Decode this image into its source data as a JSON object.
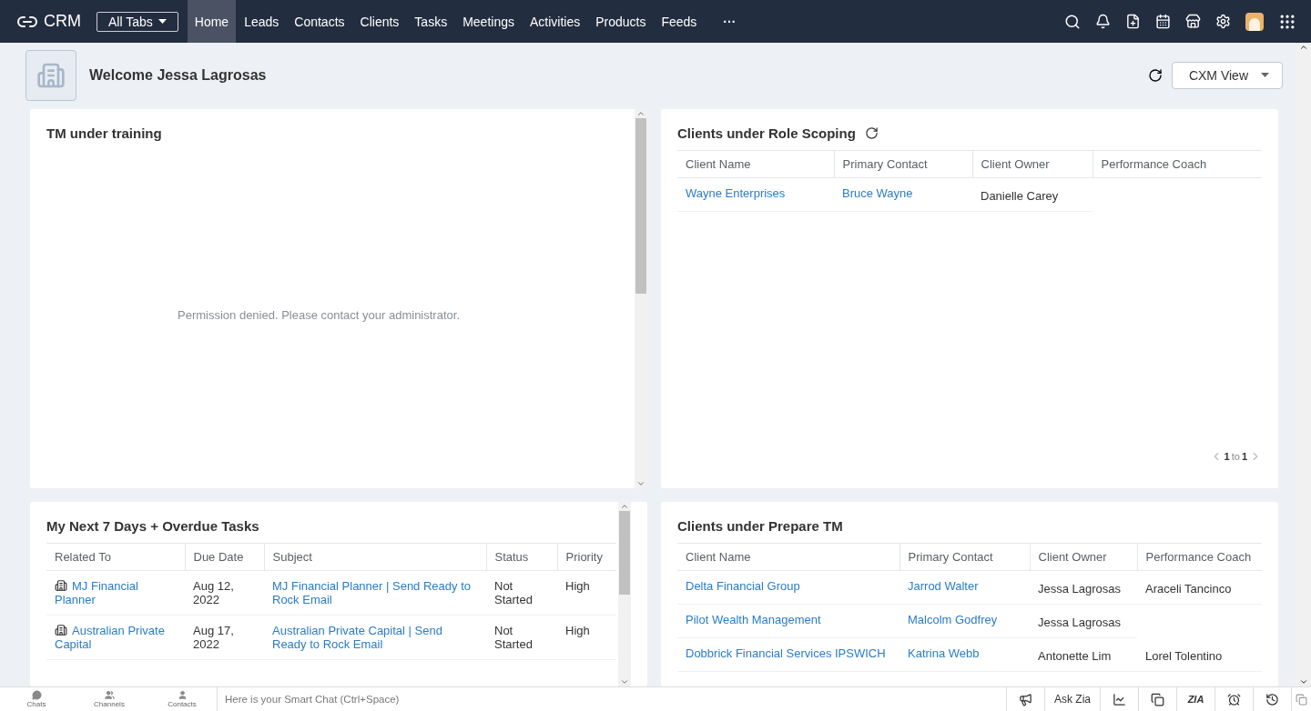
{
  "topbar": {
    "logo": "CRM",
    "all_tabs": "All Tabs",
    "more": "···",
    "tabs": [
      {
        "label": "Home",
        "selected": true
      },
      {
        "label": "Leads",
        "selected": false
      },
      {
        "label": "Contacts",
        "selected": false
      },
      {
        "label": "Clients",
        "selected": false
      },
      {
        "label": "Tasks",
        "selected": false
      },
      {
        "label": "Meetings",
        "selected": false
      },
      {
        "label": "Activities",
        "selected": false
      },
      {
        "label": "Products",
        "selected": false
      },
      {
        "label": "Feeds",
        "selected": false
      }
    ]
  },
  "welcome": "Welcome Jessa Lagrosas",
  "view_button": "CXM View",
  "panels": [
    {
      "kind": "message",
      "title": "TM under training",
      "message": "Permission denied. Please contact your administrator."
    },
    {
      "kind": "table",
      "title": "Clients under Role Scoping",
      "refresh": true,
      "columns": [
        "Client Name",
        "Primary Contact",
        "Client Owner",
        "Performance Coach"
      ],
      "rows": [
        [
          {
            "kind": "link",
            "text": "Wayne Enterprises"
          },
          {
            "kind": "link",
            "text": "Bruce Wayne"
          },
          {
            "kind": "text",
            "text": "Danielle Carey"
          }
        ]
      ],
      "pagination": {
        "from": "1",
        "sep": "to",
        "to": "1"
      }
    },
    {
      "kind": "table",
      "title": "My Next 7 Days + Overdue Tasks",
      "refresh": false,
      "columns": [
        "Related To",
        "Due Date",
        "Subject",
        "Status",
        "Priority"
      ],
      "rows": [
        [
          {
            "kind": "record",
            "text": "MJ Financial Planner"
          },
          {
            "kind": "text",
            "text": "Aug 12, 2022"
          },
          {
            "kind": "link",
            "text": "MJ Financial Planner | Send Ready to Rock Email"
          },
          {
            "kind": "text",
            "text": "Not Started"
          },
          {
            "kind": "text",
            "text": "High"
          }
        ],
        [
          {
            "kind": "record",
            "text": "Australian Private Capital"
          },
          {
            "kind": "text",
            "text": "Aug 17, 2022"
          },
          {
            "kind": "link",
            "text": "Australian Private Capital | Send Ready to Rock Email"
          },
          {
            "kind": "text",
            "text": "Not Started"
          },
          {
            "kind": "text",
            "text": "High"
          }
        ]
      ]
    },
    {
      "kind": "table",
      "title": "Clients under Prepare TM",
      "refresh": false,
      "columns": [
        "Client Name",
        "Primary Contact",
        "Client Owner",
        "Performance Coach"
      ],
      "rows": [
        [
          {
            "kind": "link",
            "text": "Delta Financial Group"
          },
          {
            "kind": "link",
            "text": "Jarrod Walter"
          },
          {
            "kind": "text",
            "text": "Jessa Lagrosas"
          },
          {
            "kind": "text",
            "text": "Araceli Tancinco"
          }
        ],
        [
          {
            "kind": "link",
            "text": "Pilot Wealth Management"
          },
          {
            "kind": "link",
            "text": "Malcolm Godfrey"
          },
          {
            "kind": "text",
            "text": "Jessa Lagrosas"
          }
        ],
        [
          {
            "kind": "link",
            "text": "Dobbrick Financial Services IPSWICH"
          },
          {
            "kind": "link",
            "text": "Katrina Webb"
          },
          {
            "kind": "text",
            "text": "Antonette Lim"
          },
          {
            "kind": "text",
            "text": "Lorel Tolentino"
          }
        ]
      ]
    }
  ],
  "bottom_bar": {
    "items": [
      "Chats",
      "Channels",
      "Contacts"
    ],
    "chat_placeholder": "Here is your Smart Chat (Ctrl+Space)",
    "ask_zia": "Ask Zia",
    "zia": "ZIA"
  }
}
